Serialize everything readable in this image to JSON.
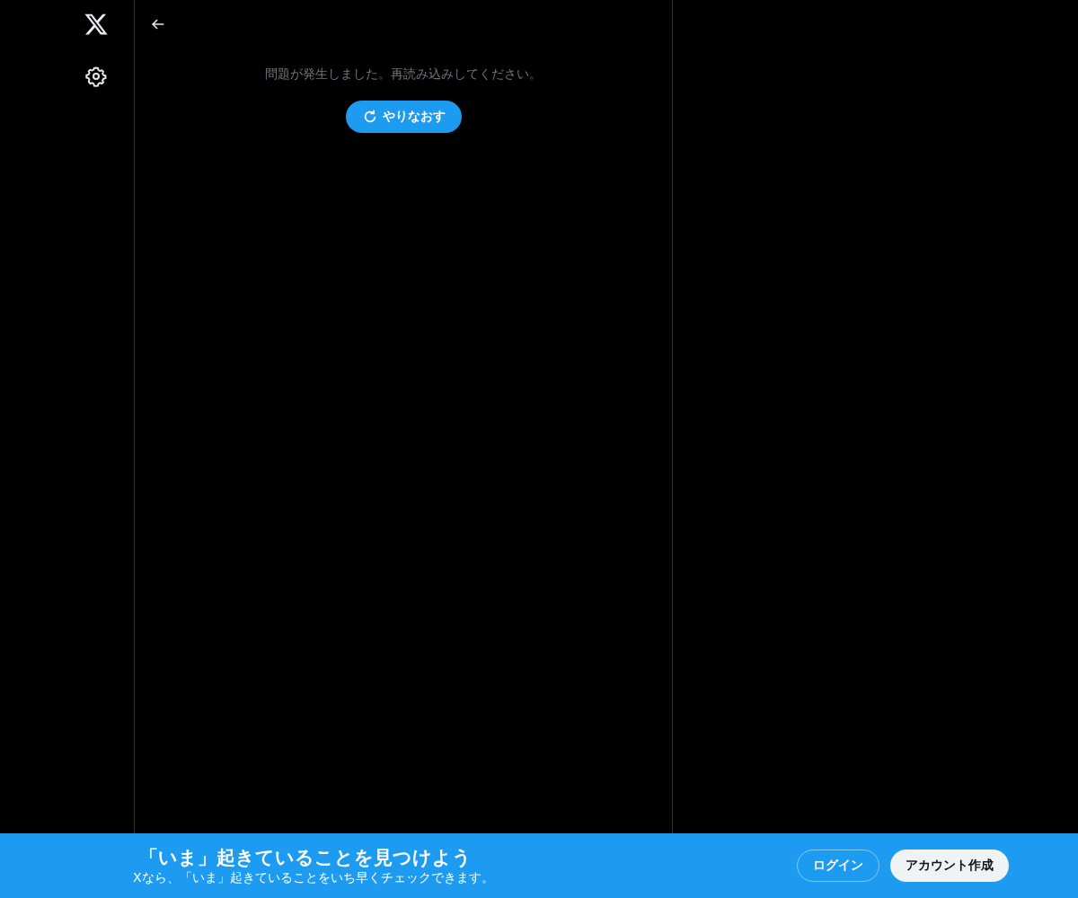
{
  "error": {
    "message": "問題が発生しました。再読み込みしてください。",
    "retry_button": "やりなおす"
  },
  "banner": {
    "title": "「いま」起きていることを見つけよう",
    "subtitle": "Xなら、「いま」起きていることをいち早くチェックできます。",
    "buttons": [
      {
        "kind": "outline",
        "label": "ログイン"
      },
      {
        "kind": "filled",
        "label": "アカウント作成"
      }
    ]
  }
}
